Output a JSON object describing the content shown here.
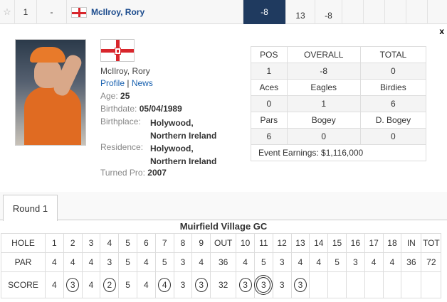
{
  "leaderboard_row": {
    "pos": "1",
    "movement": "-",
    "player": "McIlroy, Rory",
    "to_par": "-8",
    "thru": "13",
    "today": "-8"
  },
  "close_label": "x",
  "player": {
    "name": "McIlroy, Rory",
    "profile_link": "Profile",
    "separator": "|",
    "news_link": "News",
    "age_label": "Age:",
    "age": "25",
    "birthdate_label": "Birthdate:",
    "birthdate": "05/04/1989",
    "birthplace_label": "Birthplace:",
    "birthplace_line1": "Holywood,",
    "birthplace_line2": "Northern Ireland",
    "residence_label": "Residence:",
    "residence_line1": "Holywood,",
    "residence_line2": "Northern Ireland",
    "turned_pro_label": "Turned Pro:",
    "turned_pro": "2007"
  },
  "stats": {
    "row1_headers": [
      "POS",
      "OVERALL",
      "TOTAL"
    ],
    "row1_values": [
      "1",
      "-8",
      "0"
    ],
    "row2_headers": [
      "Aces",
      "Eagles",
      "Birdies"
    ],
    "row2_values": [
      "0",
      "1",
      "6"
    ],
    "row3_headers": [
      "Pars",
      "Bogey",
      "D. Bogey"
    ],
    "row3_values": [
      "6",
      "0",
      "0"
    ],
    "earnings": "Event Earnings: $1,116,000"
  },
  "tabs": [
    "Round 1"
  ],
  "scorecard": {
    "course": "Muirfield Village GC",
    "hole_label": "HOLE",
    "par_label": "PAR",
    "score_label": "SCORE",
    "holes": [
      "1",
      "2",
      "3",
      "4",
      "5",
      "6",
      "7",
      "8",
      "9",
      "OUT",
      "10",
      "11",
      "12",
      "13",
      "14",
      "15",
      "16",
      "17",
      "18",
      "IN",
      "TOT"
    ],
    "par": [
      "4",
      "4",
      "4",
      "3",
      "5",
      "4",
      "5",
      "3",
      "4",
      "36",
      "4",
      "5",
      "3",
      "4",
      "4",
      "5",
      "3",
      "4",
      "4",
      "36",
      "72"
    ],
    "score": [
      "4",
      "3",
      "4",
      "2",
      "5",
      "4",
      "4",
      "3",
      "3",
      "32",
      "3",
      "3",
      "3",
      "3",
      "",
      "",
      "",
      "",
      "",
      "",
      ""
    ],
    "score_marks": [
      "",
      "circle",
      "",
      "circle",
      "",
      "",
      "circle",
      "",
      "circle",
      "",
      "circle",
      "double",
      "",
      "circle",
      "",
      "",
      "",
      "",
      "",
      "",
      ""
    ]
  }
}
